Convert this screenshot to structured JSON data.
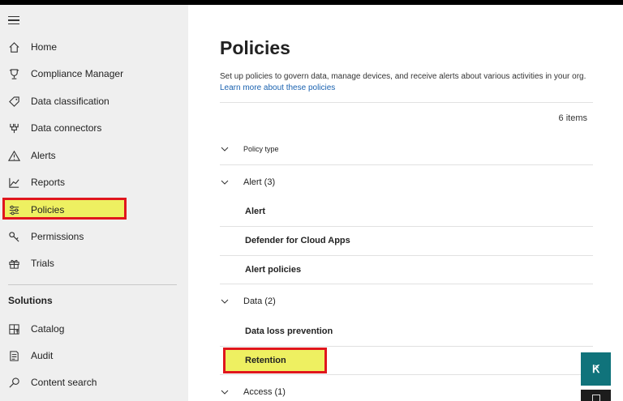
{
  "sidebar": {
    "items": [
      {
        "label": "Home",
        "icon": "home-icon"
      },
      {
        "label": "Compliance Manager",
        "icon": "trophy-icon"
      },
      {
        "label": "Data classification",
        "icon": "tag-icon"
      },
      {
        "label": "Data connectors",
        "icon": "connector-icon"
      },
      {
        "label": "Alerts",
        "icon": "warning-icon"
      },
      {
        "label": "Reports",
        "icon": "chart-icon"
      },
      {
        "label": "Policies",
        "icon": "sliders-icon"
      },
      {
        "label": "Permissions",
        "icon": "key-icon"
      },
      {
        "label": "Trials",
        "icon": "gift-icon"
      }
    ],
    "section_title": "Solutions",
    "solutions": [
      {
        "label": "Catalog",
        "icon": "catalog-icon"
      },
      {
        "label": "Audit",
        "icon": "audit-icon"
      },
      {
        "label": "Content search",
        "icon": "search-icon"
      }
    ]
  },
  "main": {
    "title": "Policies",
    "description": "Set up policies to govern data, manage devices, and receive alerts about various activities in your org.",
    "learn_more": "Learn more about these policies",
    "items_count": "6 items",
    "policy_type_label": "Policy type",
    "groups": [
      {
        "label": "Alert (3)",
        "policies": [
          "Alert",
          "Defender for Cloud Apps",
          "Alert policies"
        ]
      },
      {
        "label": "Data (2)",
        "policies": [
          "Data loss prevention",
          "Retention"
        ]
      },
      {
        "label": "Access (1)",
        "policies": []
      }
    ]
  },
  "colors": {
    "highlight": "#eef061",
    "highlight_border": "#e0161d",
    "link": "#1a62b0",
    "fab": "#10737b"
  }
}
